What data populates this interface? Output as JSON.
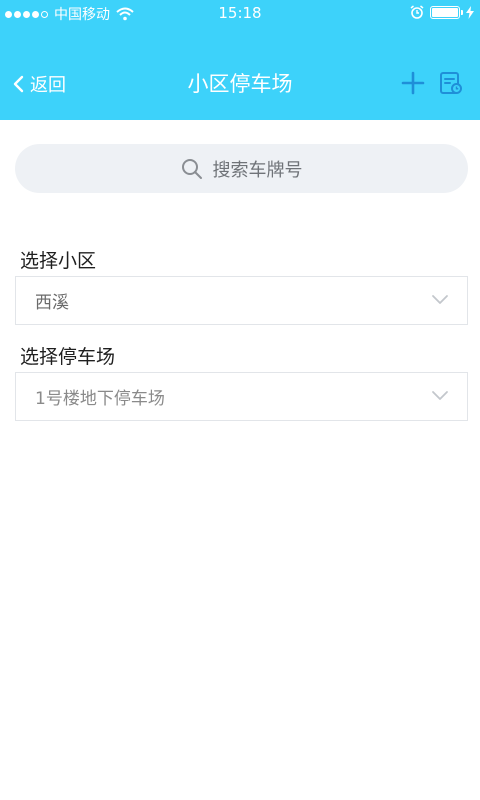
{
  "status_bar": {
    "carrier": "中国移动",
    "time": "15:18"
  },
  "nav": {
    "back_label": "返回",
    "title": "小区停车场"
  },
  "search": {
    "placeholder": "搜索车牌号"
  },
  "form": {
    "community": {
      "label": "选择小区",
      "value": "西溪"
    },
    "parking": {
      "label": "选择停车场",
      "value": "1号楼地下停车场"
    }
  },
  "colors": {
    "header_bg": "#3dd2fa",
    "icon_blue": "#1f8fd8"
  }
}
